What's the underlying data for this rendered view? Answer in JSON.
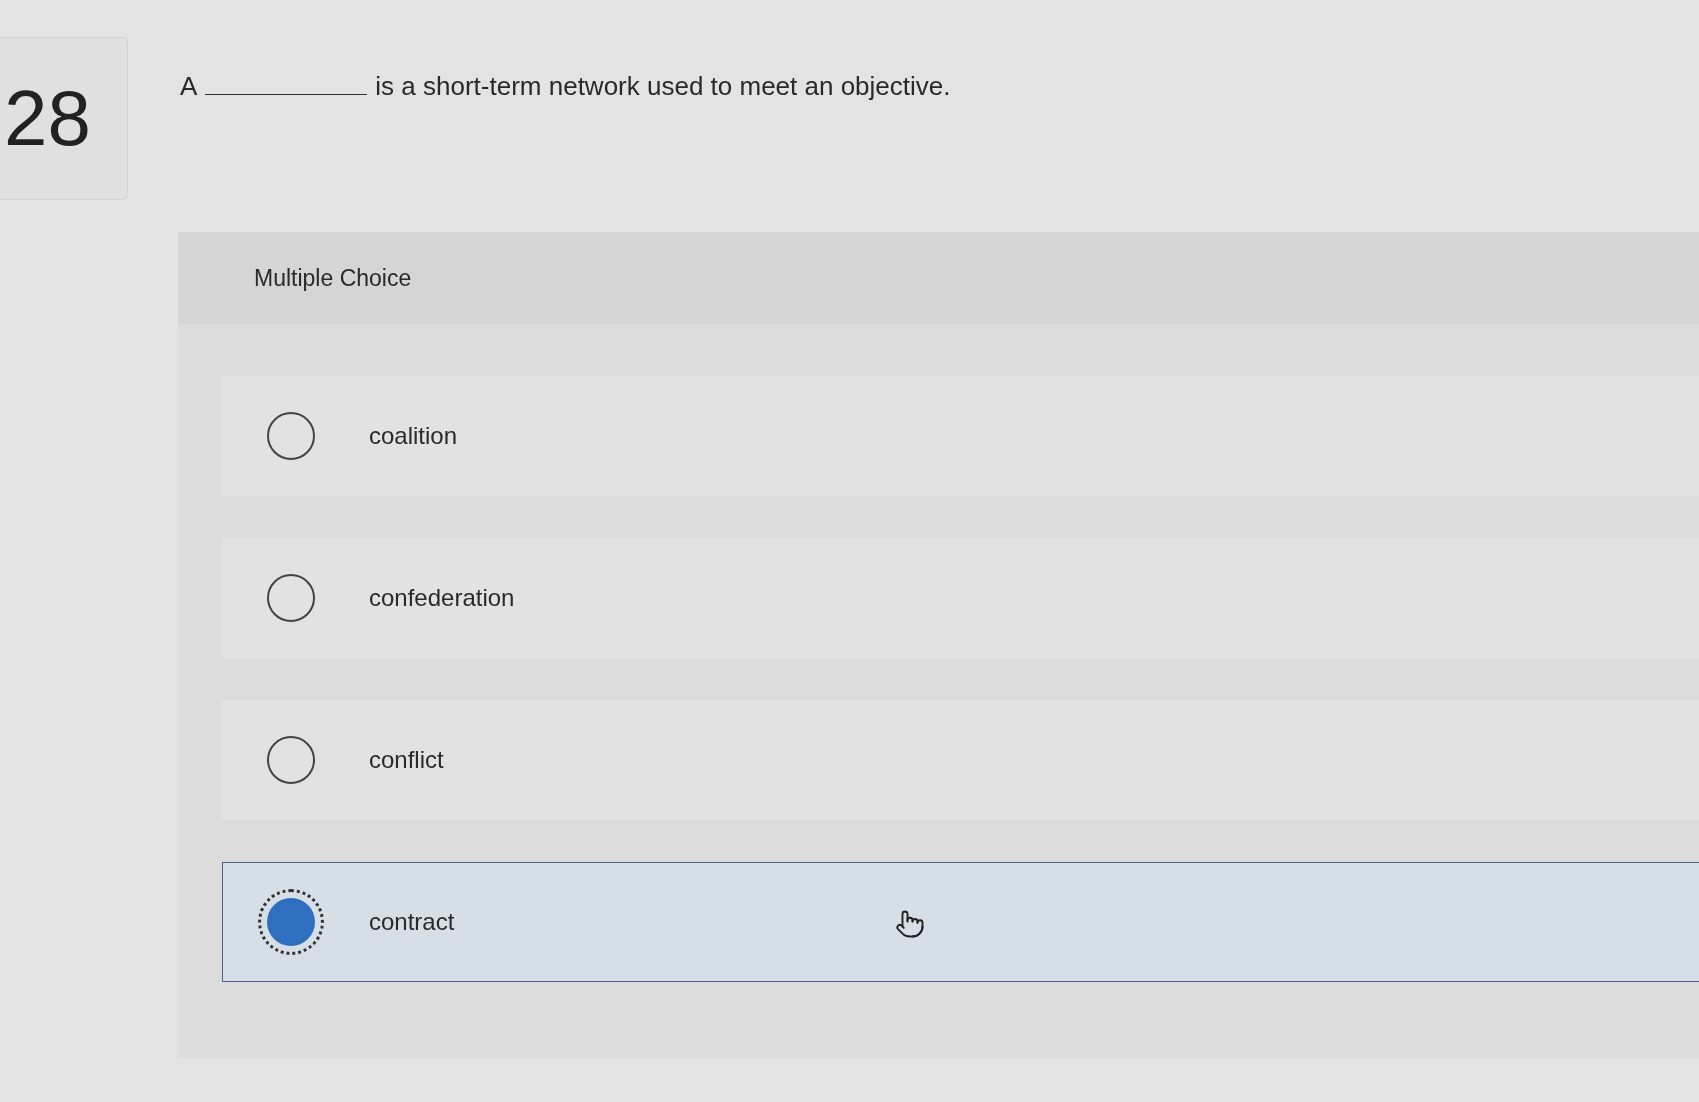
{
  "question": {
    "number": "28",
    "prefix": "A",
    "suffix": "is a short-term network used to meet an objective."
  },
  "answer_panel": {
    "type_label": "Multiple Choice",
    "options": [
      {
        "label": "coalition",
        "selected": false
      },
      {
        "label": "confederation",
        "selected": false
      },
      {
        "label": "conflict",
        "selected": false
      },
      {
        "label": "contract",
        "selected": true
      }
    ]
  }
}
